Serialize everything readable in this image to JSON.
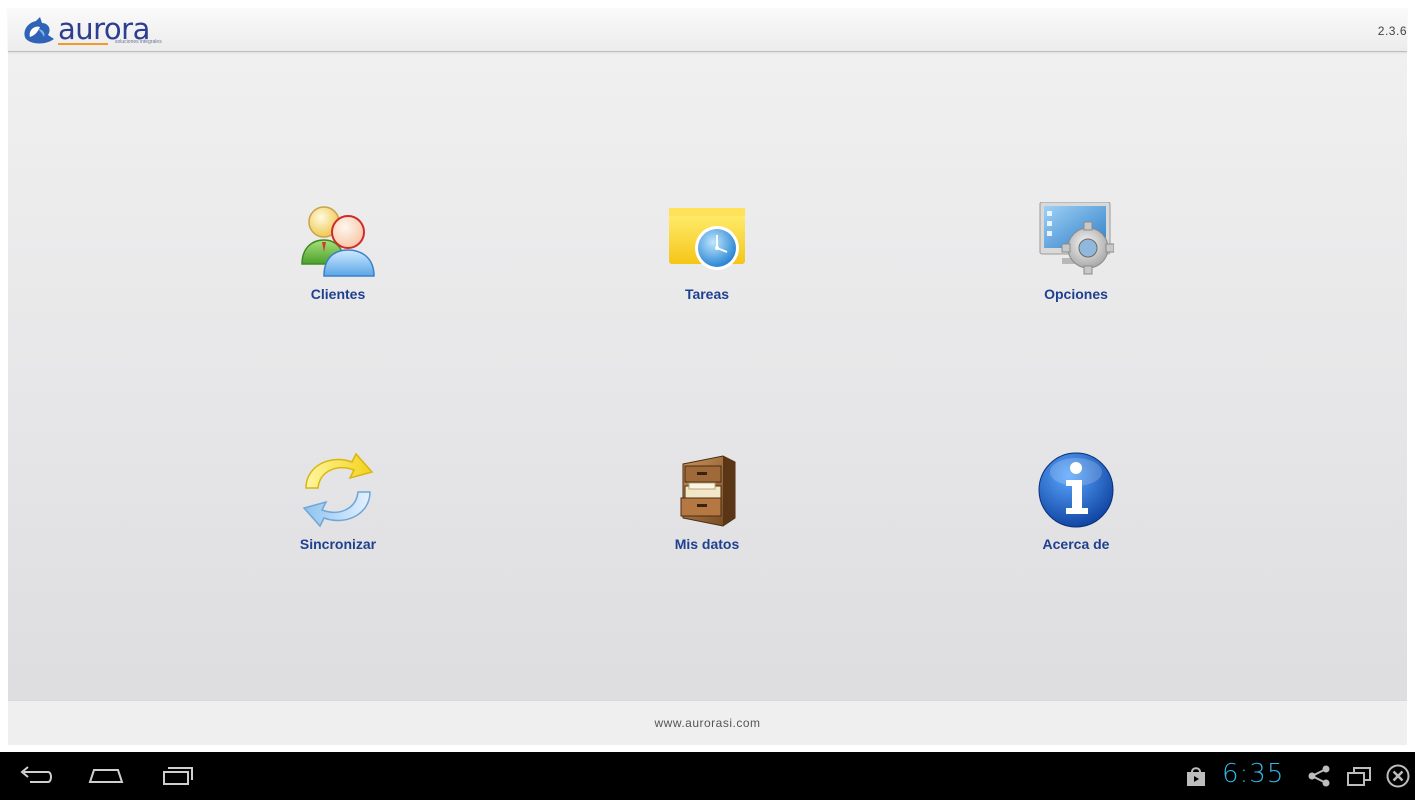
{
  "header": {
    "logo_text": "aurora",
    "logo_tagline": "soluciones integrales",
    "version": "2.3.6"
  },
  "menu": {
    "items": [
      {
        "label": "Clientes",
        "icon": "users-icon"
      },
      {
        "label": "Tareas",
        "icon": "tasks-clock-icon"
      },
      {
        "label": "Opciones",
        "icon": "settings-monitor-icon"
      },
      {
        "label": "Sincronizar",
        "icon": "sync-icon"
      },
      {
        "label": "Mis datos",
        "icon": "file-cabinet-icon"
      },
      {
        "label": "Acerca de",
        "icon": "info-icon"
      }
    ]
  },
  "footer": {
    "link": "www.aurorasi.com"
  },
  "system_bar": {
    "time": "6:35",
    "accent_color": "#33b5e5"
  }
}
